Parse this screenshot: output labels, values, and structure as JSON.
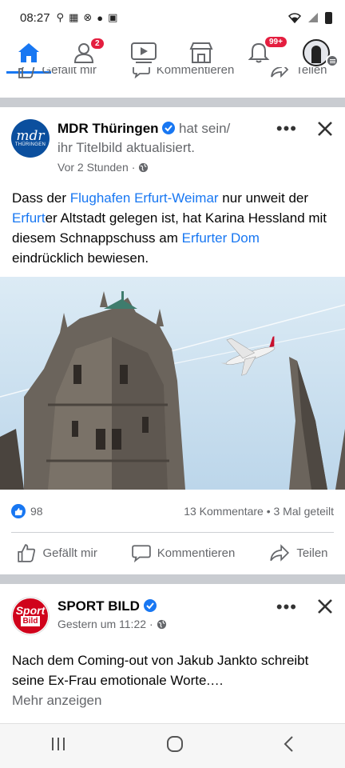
{
  "status": {
    "time": "08:27"
  },
  "nav": {
    "friends_badge": "2",
    "notifications_badge": "99+"
  },
  "prev_post": {
    "like_label": "Gefällt mir",
    "comment_label": "Kommentieren",
    "share_label": "Teilen"
  },
  "post1": {
    "author": "MDR Thüringen",
    "action_line1": " hat sein/",
    "action_line2": "ihr Titelbild aktualisiert.",
    "time": "Vor 2 Stunden",
    "avatar_text": "mdr",
    "avatar_sub": "THÜRINGEN",
    "text": {
      "t1": "Dass der ",
      "l1": "Flughafen Erfurt-Weimar",
      "t2": " nur unweit der ",
      "l2": "Erfurt",
      "t3": "er Altstadt gelegen ist, hat Karina Hessland mit diesem Schnappschuss am ",
      "l3": "Erfurter Dom",
      "t4": " eindrücklich bewiesen."
    },
    "likes": "98",
    "stats": "13 Kommentare • 3 Mal geteilt",
    "like_label": "Gefällt mir",
    "comment_label": "Kommentieren",
    "share_label": "Teilen"
  },
  "post2": {
    "author": "SPORT BILD",
    "time": "Gestern um 11:22",
    "avatar_line1": "Sport",
    "avatar_line2": "Bild",
    "text": "Nach dem Coming-out von Jakub Jankto schreibt seine Ex-Frau emotionale Worte.…",
    "more": "Mehr anzeigen"
  },
  "colors": {
    "accent": "#1877f2",
    "badge": "#e41e3f",
    "sky": "#cfe3f2"
  }
}
